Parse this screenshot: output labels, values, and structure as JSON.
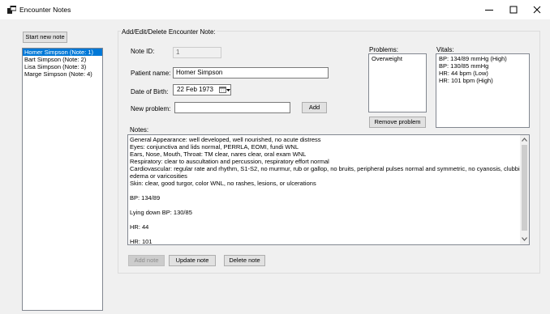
{
  "window": {
    "title": "Encounter Notes"
  },
  "sidebar": {
    "start_button": "Start new note",
    "notes": [
      {
        "label": "Homer Simpson (Note: 1)",
        "selected": true
      },
      {
        "label": "Bart Simpson (Note: 2)",
        "selected": false
      },
      {
        "label": "Lisa Simpson (Note: 3)",
        "selected": false
      },
      {
        "label": "Marge Simpson (Note: 4)",
        "selected": false
      }
    ]
  },
  "form": {
    "group_title": "Add/Edit/Delete Encounter Note:",
    "note_id_label": "Note ID:",
    "note_id_value": "1",
    "patient_name_label": "Patient name:",
    "patient_name_value": "Homer Simpson",
    "dob_label": "Date of Birth:",
    "dob_value": "22 Feb 1973",
    "new_problem_label": "New problem:",
    "new_problem_value": "",
    "add_button": "Add",
    "problems_label": "Problems:",
    "problems": [
      "Overweight"
    ],
    "remove_problem_button": "Remove problem",
    "vitals_label": "Vitals:",
    "vitals": [
      "BP: 134/89 mmHg (High)",
      "BP: 130/85 mmHg",
      "HR: 44 bpm (Low)",
      "HR: 101 bpm (High)"
    ],
    "notes_label": "Notes:",
    "notes_lines": [
      "General Appearance: well developed, well nourished, no acute distress",
      "Eyes: conjunctiva and lids normal, PERRLA, EOMI, fundi WNL",
      "Ears, Nose, Mouth, Throat: TM clear, nares clear, oral exam WNL",
      "Respiratory: clear to auscultation and percussion, respiratory effort normal",
      "Cardiovascular: regular rate and rhythm, S1-S2, no murmur, rub or gallop, no bruits, peripheral pulses normal and symmetric, no cyanosis, clubbing,",
      "edema or varicosities",
      "Skin: clear, good turgor, color WNL, no rashes, lesions, or ulcerations",
      "BP: 134/89",
      "Lying down BP: 130/85",
      "HR: 44",
      "HR: 101"
    ],
    "add_note_button": "Add note",
    "update_note_button": "Update note",
    "delete_note_button": "Delete note"
  },
  "colors": {
    "selection": "#0078d7",
    "window_bg": "#f0f0f0"
  }
}
